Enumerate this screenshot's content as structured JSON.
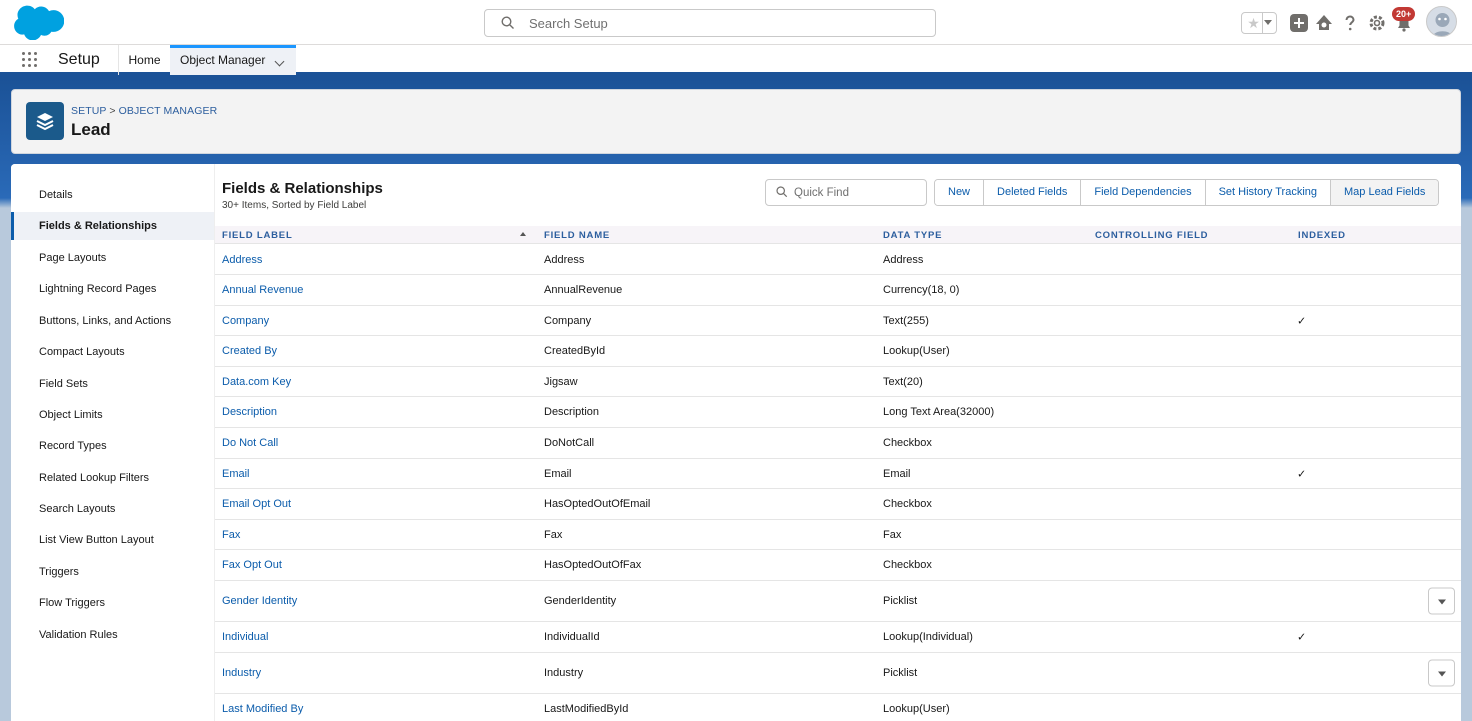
{
  "header": {
    "search_placeholder": "Search Setup",
    "notification_count": "20+",
    "icons": [
      "favorites-star-icon",
      "add-icon",
      "trailhead-icon",
      "help-icon",
      "gear-icon",
      "bell-icon",
      "avatar"
    ]
  },
  "app_nav": {
    "app_name": "Setup",
    "tabs": [
      {
        "label": "Home"
      },
      {
        "label": "Object Manager"
      }
    ]
  },
  "page_header": {
    "breadcrumb_setup": "SETUP",
    "breadcrumb_sep": ">",
    "breadcrumb_om": "OBJECT MANAGER",
    "title": "Lead"
  },
  "sidebar": {
    "items": [
      {
        "label": "Details"
      },
      {
        "label": "Fields & Relationships"
      },
      {
        "label": "Page Layouts"
      },
      {
        "label": "Lightning Record Pages"
      },
      {
        "label": "Buttons, Links, and Actions"
      },
      {
        "label": "Compact Layouts"
      },
      {
        "label": "Field Sets"
      },
      {
        "label": "Object Limits"
      },
      {
        "label": "Record Types"
      },
      {
        "label": "Related Lookup Filters"
      },
      {
        "label": "Search Layouts"
      },
      {
        "label": "List View Button Layout"
      },
      {
        "label": "Triggers"
      },
      {
        "label": "Flow Triggers"
      },
      {
        "label": "Validation Rules"
      }
    ],
    "active_index": 1
  },
  "main": {
    "title": "Fields & Relationships",
    "subtitle": "30+ Items, Sorted by Field Label",
    "quick_find_placeholder": "Quick Find",
    "buttons": [
      "New",
      "Deleted Fields",
      "Field Dependencies",
      "Set History Tracking",
      "Map Lead Fields"
    ],
    "columns": [
      "FIELD LABEL",
      "FIELD NAME",
      "DATA TYPE",
      "CONTROLLING FIELD",
      "INDEXED"
    ],
    "rows": [
      {
        "label": "Address",
        "name": "Address",
        "type": "Address",
        "controlling": "",
        "indexed": ""
      },
      {
        "label": "Annual Revenue",
        "name": "AnnualRevenue",
        "type": "Currency(18, 0)",
        "controlling": "",
        "indexed": ""
      },
      {
        "label": "Company",
        "name": "Company",
        "type": "Text(255)",
        "controlling": "",
        "indexed": "✓"
      },
      {
        "label": "Created By",
        "name": "CreatedById",
        "type": "Lookup(User)",
        "controlling": "",
        "indexed": ""
      },
      {
        "label": "Data.com Key",
        "name": "Jigsaw",
        "type": "Text(20)",
        "controlling": "",
        "indexed": ""
      },
      {
        "label": "Description",
        "name": "Description",
        "type": "Long Text Area(32000)",
        "controlling": "",
        "indexed": ""
      },
      {
        "label": "Do Not Call",
        "name": "DoNotCall",
        "type": "Checkbox",
        "controlling": "",
        "indexed": ""
      },
      {
        "label": "Email",
        "name": "Email",
        "type": "Email",
        "controlling": "",
        "indexed": "✓"
      },
      {
        "label": "Email Opt Out",
        "name": "HasOptedOutOfEmail",
        "type": "Checkbox",
        "controlling": "",
        "indexed": ""
      },
      {
        "label": "Fax",
        "name": "Fax",
        "type": "Fax",
        "controlling": "",
        "indexed": ""
      },
      {
        "label": "Fax Opt Out",
        "name": "HasOptedOutOfFax",
        "type": "Checkbox",
        "controlling": "",
        "indexed": ""
      },
      {
        "label": "Gender Identity",
        "name": "GenderIdentity",
        "type": "Picklist",
        "controlling": "",
        "indexed": "",
        "menu": true
      },
      {
        "label": "Individual",
        "name": "IndividualId",
        "type": "Lookup(Individual)",
        "controlling": "",
        "indexed": "✓"
      },
      {
        "label": "Industry",
        "name": "Industry",
        "type": "Picklist",
        "controlling": "",
        "indexed": "",
        "menu": true
      },
      {
        "label": "Last Modified By",
        "name": "LastModifiedById",
        "type": "Lookup(User)",
        "controlling": "",
        "indexed": ""
      }
    ]
  },
  "colors": {
    "brand_blue": "#1b5297",
    "link_blue": "#0b5cab",
    "salesforce_cloud": "#00a1e0",
    "badge_red": "#c23934"
  }
}
